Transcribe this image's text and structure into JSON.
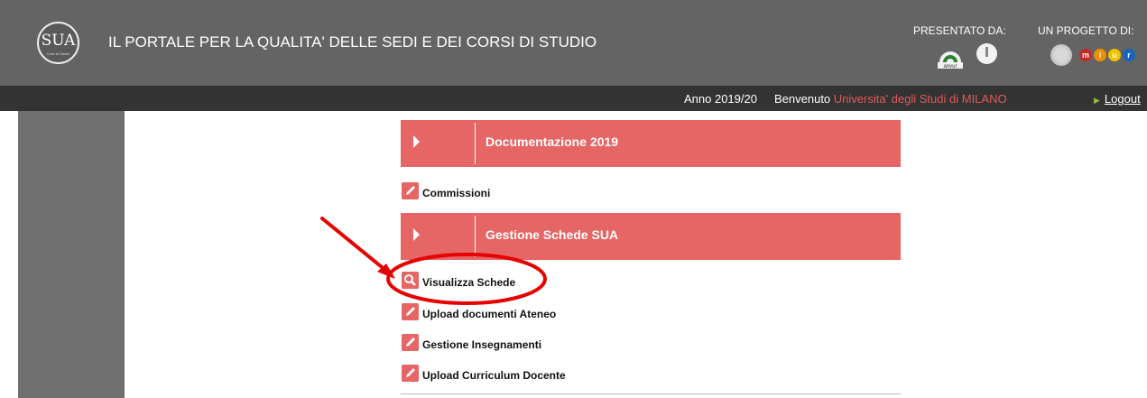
{
  "header": {
    "logo_text": "SUA",
    "logo_subtext": "Corsi di Studio",
    "title": "IL PORTALE PER LA QUALITA' DELLE SEDI E DEI CORSI DI STUDIO",
    "presented_by": "PRESENTATO DA:",
    "project_by": "UN PROGETTO DI:",
    "anvur_label": "anvur",
    "miur_letters": [
      "m",
      "i",
      "u",
      "r"
    ]
  },
  "topbar": {
    "year": "Anno 2019/20",
    "welcome": "Benvenuto",
    "university": "Universita' degli Studi di MILANO",
    "logout": "Logout"
  },
  "menu": {
    "section1": "Documentazione 2019",
    "item_commissioni": "Commissioni",
    "section2": "Gestione Schede SUA",
    "items": [
      {
        "label": "Visualizza Schede",
        "icon": "magnifier-icon"
      },
      {
        "label": "Upload documenti Ateneo",
        "icon": "pencil-icon"
      },
      {
        "label": "Gestione Insegnamenti",
        "icon": "pencil-icon"
      },
      {
        "label": "Upload Curriculum Docente",
        "icon": "pencil-icon"
      }
    ]
  },
  "colors": {
    "accent": "#e66565",
    "header_bg": "#646464",
    "topbar_bg": "#333333",
    "annotation": "#e60000"
  }
}
